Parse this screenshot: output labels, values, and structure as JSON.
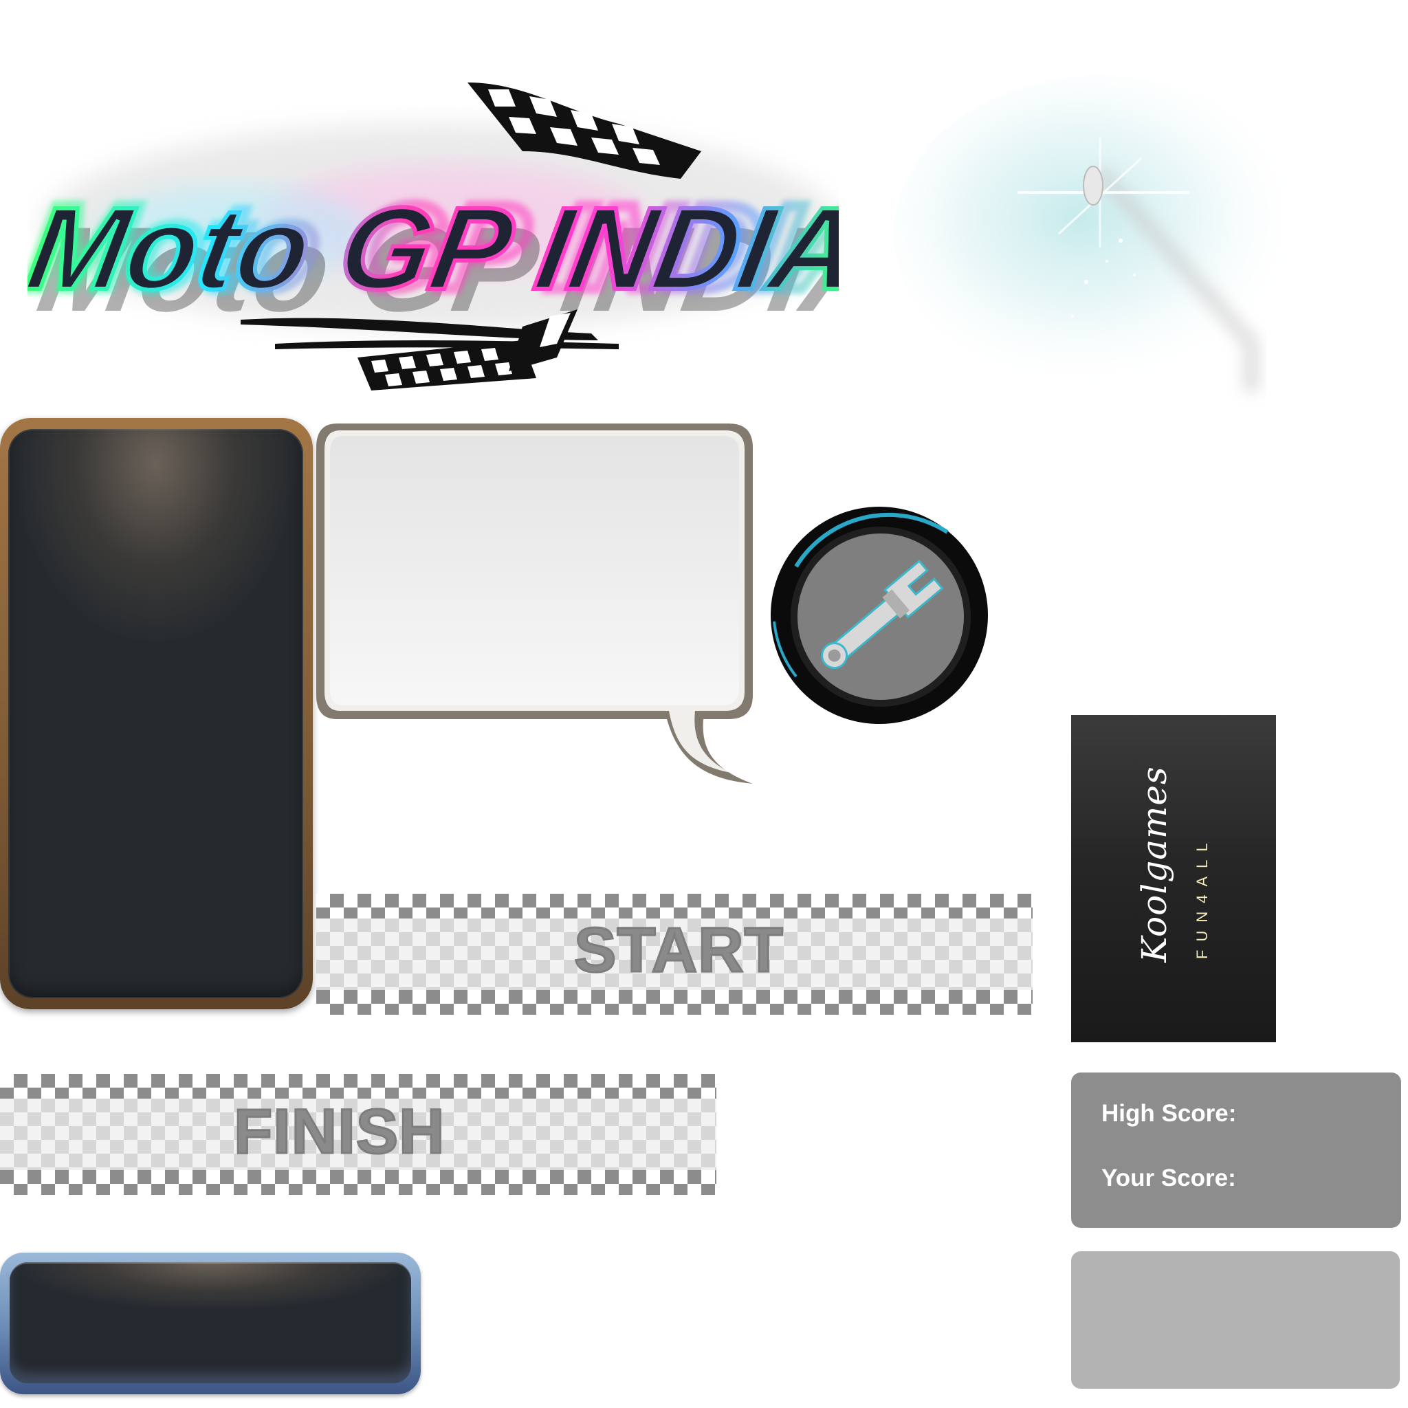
{
  "logo": {
    "title": "Moto GP INDIA"
  },
  "banners": {
    "start_label": "START",
    "finish_label": "FINISH"
  },
  "brand_panel": {
    "brand": "Koolgames",
    "tagline": "FUN4ALL"
  },
  "score_panel": {
    "high_score_label": "High Score:",
    "your_score_label": "Your Score:"
  },
  "icons": {
    "settings": "wrench-icon"
  },
  "colors": {
    "neon_green": "#3dff7a",
    "neon_cyan": "#28e4ff",
    "neon_pink": "#ff3fb8",
    "neon_blue": "#5aa0ff",
    "score_bg": "#8d8d8d",
    "checker": "#8c8c8c"
  }
}
